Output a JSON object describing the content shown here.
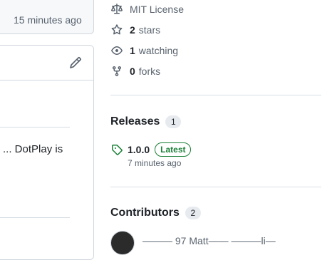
{
  "left": {
    "commit_time": "15 minutes ago",
    "readme_fragment": "... DotPlay is"
  },
  "about": {
    "license": "MIT License",
    "stars_count": "2",
    "stars_label": "stars",
    "watching_count": "1",
    "watching_label": "watching",
    "forks_count": "0",
    "forks_label": "forks"
  },
  "releases": {
    "title": "Releases",
    "count": "1",
    "latest_name": "1.0.0",
    "latest_badge": "Latest",
    "latest_time": "7 minutes ago"
  },
  "contributors": {
    "title": "Contributors",
    "count": "2",
    "first_name_partial": "——— 97 Matt—— ———li—"
  },
  "colors": {
    "border": "#d0d7de",
    "muted_text": "#59636e",
    "success": "#1a7f37",
    "text": "#1f2328"
  }
}
